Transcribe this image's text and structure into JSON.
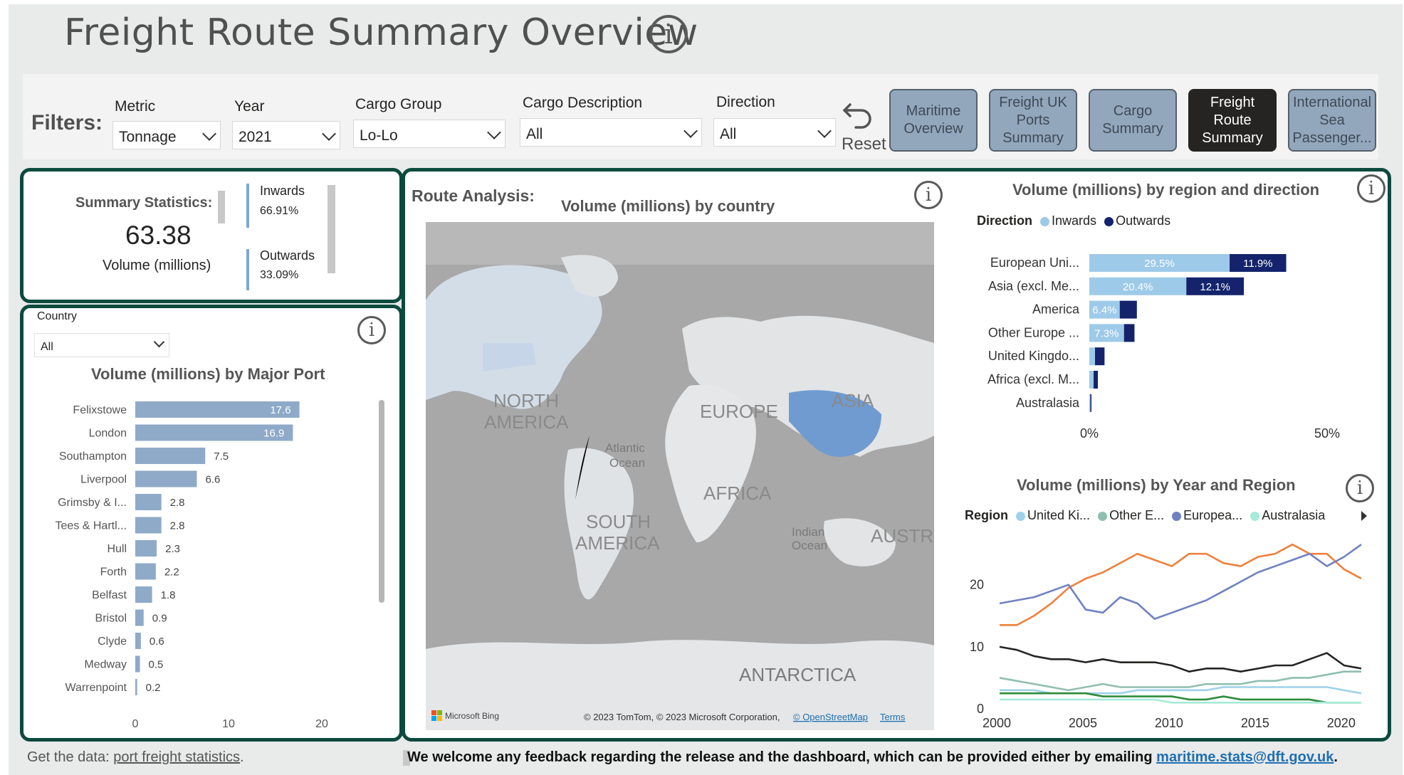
{
  "page": {
    "title": "Freight Route Summary Overview"
  },
  "filters": {
    "label": "Filters:",
    "metric": {
      "label": "Metric",
      "value": "Tonnage"
    },
    "year": {
      "label": "Year",
      "value": "2021"
    },
    "cargo_group": {
      "label": "Cargo Group",
      "value": "Lo-Lo"
    },
    "cargo_description": {
      "label": "Cargo Description",
      "value": "All"
    },
    "direction": {
      "label": "Direction",
      "value": "All"
    },
    "reset_label": "Reset"
  },
  "nav": {
    "buttons": [
      {
        "label": "Maritime Overview"
      },
      {
        "label": "Freight UK Ports Summary"
      },
      {
        "label": "Cargo Summary"
      },
      {
        "label": "Freight Route Summary"
      },
      {
        "label": "International Sea Passenger..."
      }
    ]
  },
  "summary": {
    "title": "Summary Statistics:",
    "value": "63.38",
    "value_label": "Volume (millions)",
    "inwards_label": "Inwards",
    "inwards_pct": "66.91%",
    "outwards_label": "Outwards",
    "outwards_pct": "33.09%"
  },
  "port_panel": {
    "country_label": "Country",
    "country_value": "All"
  },
  "route": {
    "label": "Route Analysis:",
    "map_title": "Volume (millions) by country",
    "map_labels": [
      "NORTH AMERICA",
      "EUROPE",
      "ASIA",
      "AFRICA",
      "SOUTH AMERICA",
      "ANTARCTICA",
      "AUSTRA",
      "Atlantic Ocean",
      "Indian Ocean"
    ],
    "attribution": "© 2023 TomTom, © 2023 Microsoft Corporation,",
    "osm_link": "© OpenStreetMap",
    "terms_link": "Terms",
    "bing": "Microsoft Bing"
  },
  "footer": {
    "get_data": "Get the data:",
    "get_data_link": "port freight statistics",
    "feedback": "We welcome any feedback regarding the release and the dashboard, which can be provided either by emailing",
    "email": "maritime.stats@dft.gov.uk"
  },
  "colors": {
    "accent_dark": "#0d4a3e",
    "bar": "#8eaac8",
    "inwards": "#9ecae9",
    "outwards": "#14236b"
  },
  "chart_data": [
    {
      "type": "bar",
      "title": "Volume (millions) by Major Port",
      "orientation": "horizontal",
      "categories": [
        "Felixstowe",
        "London",
        "Southampton",
        "Liverpool",
        "Grimsby & I...",
        "Tees & Hartl...",
        "Hull",
        "Forth",
        "Belfast",
        "Bristol",
        "Clyde",
        "Medway",
        "Warrenpoint"
      ],
      "values": [
        17.6,
        16.9,
        7.5,
        6.6,
        2.8,
        2.8,
        2.3,
        2.2,
        1.8,
        0.9,
        0.6,
        0.5,
        0.2
      ],
      "xlim": [
        0,
        20
      ],
      "xticks": [
        "0",
        "10",
        "20"
      ]
    },
    {
      "type": "bar",
      "title": "Volume (millions) by region and direction",
      "orientation": "horizontal",
      "stacked": true,
      "legend_title": "Direction",
      "categories": [
        "European Uni...",
        "Asia (excl. Me...",
        "America",
        "Other Europe ...",
        "United Kingdo...",
        "Africa (excl. M...",
        "Australasia"
      ],
      "series": [
        {
          "name": "Inwards",
          "values": [
            29.5,
            20.4,
            6.4,
            7.3,
            1.2,
            0.9,
            0.2
          ],
          "labels": [
            "29.5%",
            "20.4%",
            "6.4%",
            "7.3%",
            "",
            "",
            ""
          ]
        },
        {
          "name": "Outwards",
          "values": [
            11.9,
            12.1,
            3.6,
            2.2,
            2.0,
            0.9,
            0.1
          ],
          "labels": [
            "11.9%",
            "12.1%",
            "",
            "",
            "",
            "",
            ""
          ]
        }
      ],
      "xticks": [
        "0%",
        "50%"
      ],
      "xlim": [
        0,
        50
      ]
    },
    {
      "type": "line",
      "title": "Volume (millions) by Year and Region",
      "legend_title": "Region",
      "legend": [
        "United Ki...",
        "Other E...",
        "Europea...",
        "Australasia"
      ],
      "x": [
        2000,
        2001,
        2002,
        2003,
        2004,
        2005,
        2006,
        2007,
        2008,
        2009,
        2010,
        2011,
        2012,
        2013,
        2014,
        2015,
        2016,
        2017,
        2018,
        2019,
        2020,
        2021
      ],
      "series": [
        {
          "color": "#f0803c",
          "values": [
            13.5,
            13.5,
            15,
            17,
            19.5,
            21,
            22,
            23.5,
            25,
            24,
            23,
            25,
            25,
            23.5,
            23,
            24.5,
            25,
            26.5,
            25,
            25,
            22.5,
            21
          ]
        },
        {
          "color": "#6f82c0",
          "values": [
            17,
            17.5,
            18,
            19,
            20,
            16,
            15.5,
            18,
            17,
            14.5,
            15.5,
            16.5,
            17.5,
            19,
            20.5,
            22,
            23,
            24,
            25,
            23,
            24.5,
            26.5
          ]
        },
        {
          "color": "#252423",
          "values": [
            10,
            9.5,
            8.5,
            8,
            8,
            7.5,
            8,
            7.5,
            7.5,
            7.5,
            7,
            6,
            6.5,
            6.5,
            6,
            6.5,
            7,
            7,
            8,
            9,
            7,
            6.5
          ]
        },
        {
          "color": "#8fbfb0",
          "values": [
            5,
            4.5,
            4,
            3.5,
            3,
            3.5,
            4,
            3.5,
            3.5,
            3.5,
            3.5,
            3.5,
            4,
            4,
            4,
            4.5,
            4.5,
            5,
            5,
            5.5,
            6,
            6
          ]
        },
        {
          "color": "#9ed0ea",
          "values": [
            3,
            3,
            3,
            2.5,
            2.5,
            2.5,
            2.5,
            2.5,
            3,
            3,
            3,
            3,
            3,
            3.5,
            3.5,
            3.5,
            3.5,
            3.5,
            3.5,
            3.5,
            3,
            2.5
          ]
        },
        {
          "color": "#2e8b3a",
          "values": [
            2.5,
            2.5,
            2.5,
            2.5,
            2.5,
            2.5,
            2,
            2,
            2,
            2,
            2,
            1.5,
            1.5,
            2,
            1.5,
            1.5,
            1.5,
            1.5,
            1.5,
            1,
            1,
            1
          ]
        },
        {
          "color": "#a6ead8",
          "values": [
            1.5,
            1.5,
            1.5,
            1.5,
            1.5,
            1.5,
            1.5,
            1.5,
            1.5,
            1.5,
            1,
            1,
            1,
            1,
            1,
            1,
            1,
            1,
            1,
            1,
            1,
            1
          ]
        }
      ],
      "ylim": [
        0,
        28
      ],
      "yticks": [
        0,
        10,
        20
      ],
      "xticks": [
        2000,
        2005,
        2010,
        2015,
        2020
      ]
    }
  ]
}
